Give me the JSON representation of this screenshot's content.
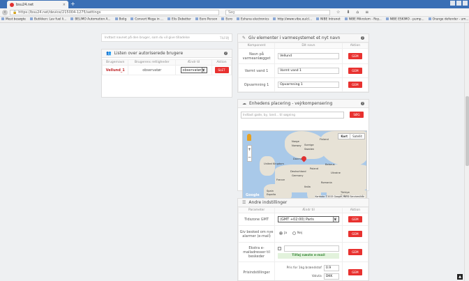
{
  "browser": {
    "tab_title": "bsu24.net",
    "url": "https://bsu24.net/device/215004-1275/settings",
    "search_placeholder": "Søg",
    "bookmarks": [
      "Mest besøgte",
      "Butikken: Lav fuel li...",
      "BELIMO Automation A...",
      "Bolig",
      "Convert Mega in ...",
      "Elis Debetter",
      "Eero Person",
      "Eero",
      "Eshuna electronics",
      "http://www.vibe.eu/cl...",
      "NIBE Intranet",
      "NIBE Mikrolem - Roy...",
      "NIBE ESKIMO - pump...",
      "Orange defender - um..."
    ]
  },
  "left_top_text": "Indtast navnet på den bruger, som du vil give tilladelse",
  "left_top_button": "TILFØJ",
  "users_panel": {
    "title": "Listen over autoriserede brugere",
    "headers": [
      "Brugernavn",
      "Brugerens rettigheder",
      "Ændr til",
      "Aktion"
    ],
    "row": {
      "username": "Vellund_1",
      "right": "observatør",
      "change_to": "observatør",
      "action": "SLET"
    }
  },
  "elements_panel": {
    "title": "Giv elementer i varmesystemet et nyt navn",
    "headers": [
      "Komponent",
      "Dit navn",
      "Aktion"
    ],
    "rows": [
      {
        "component": "Navn på varmeanlægget",
        "value": "Vellund",
        "action": "GEM"
      },
      {
        "component": "Varmt vand 1",
        "value": "Varmt vand 1",
        "action": "GEM"
      },
      {
        "component": "Opvarmning 1",
        "value": "Opvarmning 1",
        "action": "GEM"
      }
    ]
  },
  "placement_panel": {
    "title": "Enhedens placering - vejrkompensering",
    "search_placeholder": "Indtast gade, by, land... til søgning",
    "search_button": "SØG",
    "map_types": [
      "Kort",
      "Satellit"
    ],
    "map_labels": [
      "Norge",
      "Sverige",
      "Finland",
      "Norway",
      "Sweden",
      "United Kingdom",
      "Danmark",
      "Belarus",
      "Poland",
      "Deutschland",
      "Ukraine",
      "Germany",
      "France",
      "Romania",
      "Italia",
      "Spain",
      "España",
      "Türkiye",
      "Turkey"
    ],
    "google": "Google",
    "footer": "Kortdata ©2015 Google, INEGI  Servicevilkår"
  },
  "other_panel": {
    "title": "Andre indstillinger",
    "headers": [
      "Parameter",
      "Ændr til",
      "Aktion"
    ],
    "timezone_label": "Tidszone GMT",
    "timezone_value": "(GMT +02:00) Paris",
    "timezone_action": "GEM",
    "notify_label": "Giv besked om nye alarmer (e-mail)",
    "notify_yes": "Ja",
    "notify_no": "Nej",
    "notify_action": "GEM",
    "emails_label": "Ekstra e-mailadresser til beskeder",
    "emails_add": "Tilføj næste e-mail",
    "emails_action": "GEM",
    "price_label": "Prisindstillinger",
    "price_field": "Pris for 1kg brændstof",
    "price_value": "0.9",
    "currency_label": "Valuta",
    "currency_value": "DKK",
    "price_action": "GEM"
  }
}
